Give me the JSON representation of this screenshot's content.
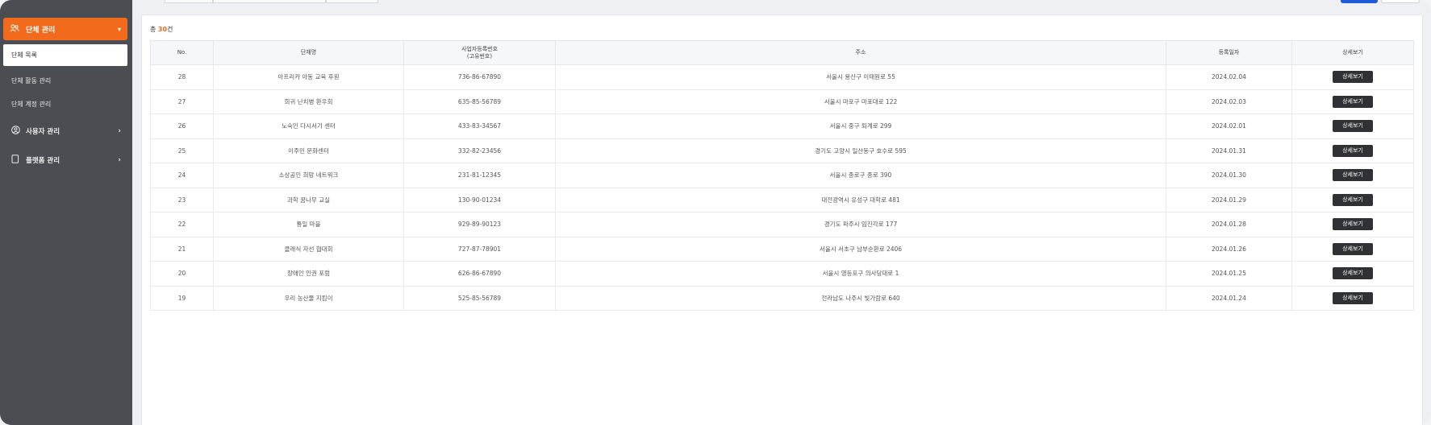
{
  "sidebar": {
    "group_org": {
      "label": "단체 관리"
    },
    "org_sub": [
      {
        "label": "단체 목록"
      },
      {
        "label": "단체 활동 관리"
      },
      {
        "label": "단체 계정 관리"
      }
    ],
    "group_user": {
      "label": "사용자 관리"
    },
    "group_platform": {
      "label": "플랫폼 관리"
    }
  },
  "summary": {
    "prefix": "총 ",
    "count": "30",
    "suffix": "건"
  },
  "table": {
    "headers": [
      "No.",
      "단체명",
      "사업자등록번호\n(고유번호)",
      "주소",
      "등록일자",
      "상세보기"
    ],
    "detail_label": "상세보기",
    "rows": [
      {
        "no": "28",
        "name": "아프리카 아동 교육 후원",
        "biz": "736-86-67890",
        "addr": "서울시 용산구 이태원로 55",
        "date": "2024.02.04"
      },
      {
        "no": "27",
        "name": "희귀 난치병 환우회",
        "biz": "635-85-56789",
        "addr": "서울시 마포구 마포대로 122",
        "date": "2024.02.03"
      },
      {
        "no": "26",
        "name": "노숙인 다시서기 센터",
        "biz": "433-83-34567",
        "addr": "서울시 중구 퇴계로 299",
        "date": "2024.02.01"
      },
      {
        "no": "25",
        "name": "이주민 문화센터",
        "biz": "332-82-23456",
        "addr": "경기도 고양시 일산동구 호수로 595",
        "date": "2024.01.31"
      },
      {
        "no": "24",
        "name": "소상공인 희망 네트워크",
        "biz": "231-81-12345",
        "addr": "서울시 종로구 종로 390",
        "date": "2024.01.30"
      },
      {
        "no": "23",
        "name": "과학 꿈나무 교실",
        "biz": "130-90-01234",
        "addr": "대전광역시 유성구 대학로 481",
        "date": "2024.01.29"
      },
      {
        "no": "22",
        "name": "통일 마을",
        "biz": "929-89-90123",
        "addr": "경기도 파주시 임진각로 177",
        "date": "2024.01.28"
      },
      {
        "no": "21",
        "name": "클래식 자선 협대회",
        "biz": "727-87-78901",
        "addr": "서울시 서초구 남부순환로 2406",
        "date": "2024.01.26"
      },
      {
        "no": "20",
        "name": "장애인 인권 포럼",
        "biz": "626-86-67890",
        "addr": "서울시 영등포구 의사당대로 1",
        "date": "2024.01.25"
      },
      {
        "no": "19",
        "name": "우리 농산물 지킴이",
        "biz": "525-85-56789",
        "addr": "전라남도 나주시 빛가람로 640",
        "date": "2024.01.24"
      }
    ]
  },
  "colors": {
    "accent": "#f26b1d",
    "sidebar_bg": "#4a4d52",
    "button_dark": "#2f3135",
    "top_primary": "#1e5bd8"
  },
  "icons": {
    "org": "users-icon",
    "user": "user-circle-icon",
    "platform": "document-icon",
    "chevron": "chevron-right-icon"
  }
}
